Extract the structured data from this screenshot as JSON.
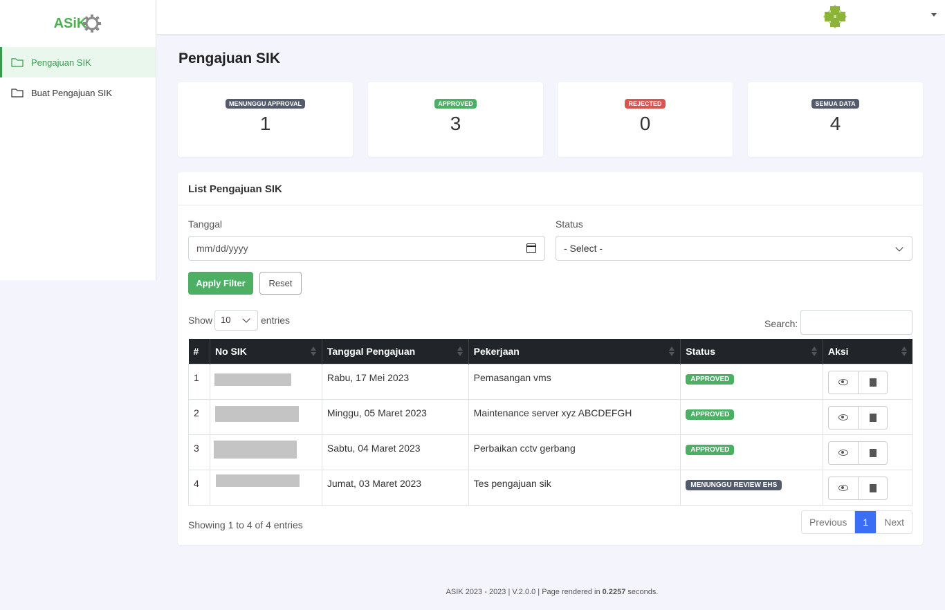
{
  "app": {
    "logo_text": "ASiK"
  },
  "sidebar": {
    "items": [
      {
        "label": "Pengajuan SIK",
        "active": true
      },
      {
        "label": "Buat Pengajuan SIK",
        "active": false
      }
    ]
  },
  "page": {
    "title": "Pengajuan SIK"
  },
  "stats": [
    {
      "label": "MENUNGGU APPROVAL",
      "value": "1",
      "color": "#525a6b"
    },
    {
      "label": "APPROVED",
      "value": "3",
      "color": "#4caf64"
    },
    {
      "label": "REJECTED",
      "value": "0",
      "color": "#d9534f"
    },
    {
      "label": "SEMUA DATA",
      "value": "4",
      "color": "#525a6b"
    }
  ],
  "list": {
    "title": "List Pengajuan SIK",
    "filter": {
      "date_label": "Tanggal",
      "date_placeholder": "mm/dd/yyyy",
      "status_label": "Status",
      "status_value": "- Select -",
      "apply_label": "Apply Filter",
      "reset_label": "Reset"
    },
    "length": {
      "show": "Show",
      "value": "10",
      "entries": "entries"
    },
    "search_label": "Search:",
    "columns": [
      "#",
      "No SIK",
      "Tanggal Pengajuan",
      "Pekerjaan",
      "Status",
      "Aksi"
    ],
    "rows": [
      {
        "no": "1",
        "tanggal": "Rabu, 17 Mei 2023",
        "pekerjaan": "Pemasangan vms",
        "status": "APPROVED",
        "status_color": "#4caf64"
      },
      {
        "no": "2",
        "tanggal": "Minggu, 05 Maret 2023",
        "pekerjaan": "Maintenance server xyz ABCDEFGH",
        "status": "APPROVED",
        "status_color": "#4caf64"
      },
      {
        "no": "3",
        "tanggal": "Sabtu, 04 Maret 2023",
        "pekerjaan": "Perbaikan cctv gerbang",
        "status": "APPROVED",
        "status_color": "#4caf64"
      },
      {
        "no": "4",
        "tanggal": "Jumat, 03 Maret 2023",
        "pekerjaan": "Tes pengajuan sik",
        "status": "MENUNGGU REVIEW EHS",
        "status_color": "#525a6b"
      }
    ],
    "info": "Showing 1 to 4 of 4 entries",
    "pager": {
      "prev": "Previous",
      "current": "1",
      "next": "Next"
    }
  },
  "footer": {
    "prefix": "ASIK 2023 - 2023 | V.2.0.0 | Page rendered in ",
    "time": "0.2257",
    "suffix": " seconds."
  }
}
